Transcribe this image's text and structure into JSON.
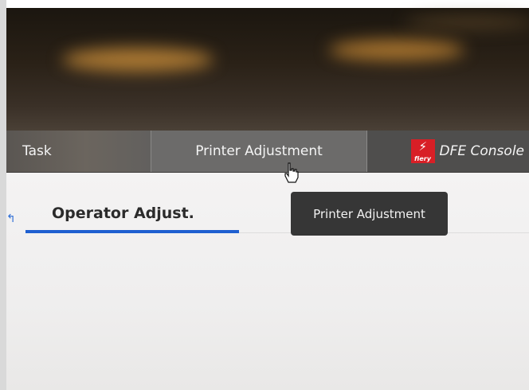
{
  "tabs": {
    "task": "Task",
    "printer_adjustment": "Printer Adjustment",
    "dfe_console": "DFE Console"
  },
  "fiery_logo": {
    "text": "fiery",
    "icon": "fiery-bolt-icon",
    "color": "#d81f26"
  },
  "subtab": {
    "label": "Operator Adjust.",
    "underline_color": "#1f5fd0"
  },
  "tooltip": {
    "text": "Printer Adjustment"
  },
  "icons": {
    "back": "back-arrow-icon",
    "cursor": "hand-pointer-icon"
  }
}
